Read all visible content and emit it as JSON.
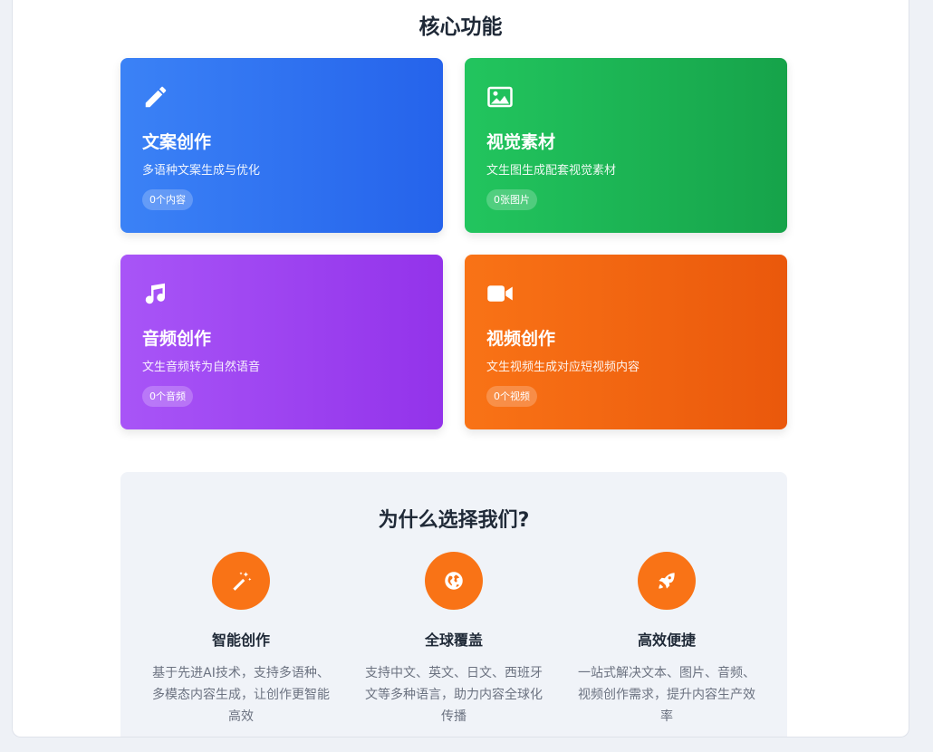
{
  "core": {
    "title": "核心功能",
    "cards": [
      {
        "icon": "pencil-icon",
        "title": "文案创作",
        "desc": "多语种文案生成与优化",
        "badge": "0个内容",
        "color_start": "#3b82f6",
        "color_end": "#2563eb"
      },
      {
        "icon": "image-icon",
        "title": "视觉素材",
        "desc": "文生图生成配套视觉素材",
        "badge": "0张图片",
        "color_start": "#22c55e",
        "color_end": "#16a34a"
      },
      {
        "icon": "music-icon",
        "title": "音频创作",
        "desc": "文生音频转为自然语音",
        "badge": "0个音频",
        "color_start": "#a855f7",
        "color_end": "#9333ea"
      },
      {
        "icon": "video-camera-icon",
        "title": "视频创作",
        "desc": "文生视频生成对应短视频内容",
        "badge": "0个视频",
        "color_start": "#f97316",
        "color_end": "#ea580c"
      }
    ]
  },
  "why": {
    "title": "为什么选择我们?",
    "features": [
      {
        "icon": "magic-wand-icon",
        "title": "智能创作",
        "desc": "基于先进AI技术，支持多语种、多模态内容生成，让创作更智能高效"
      },
      {
        "icon": "globe-icon",
        "title": "全球覆盖",
        "desc": "支持中文、英文、日文、西班牙文等多种语言，助力内容全球化传播"
      },
      {
        "icon": "rocket-icon",
        "title": "高效便捷",
        "desc": "一站式解决文本、图片、音频、视频创作需求，提升内容生产效率"
      }
    ],
    "accent": "#f97316"
  }
}
